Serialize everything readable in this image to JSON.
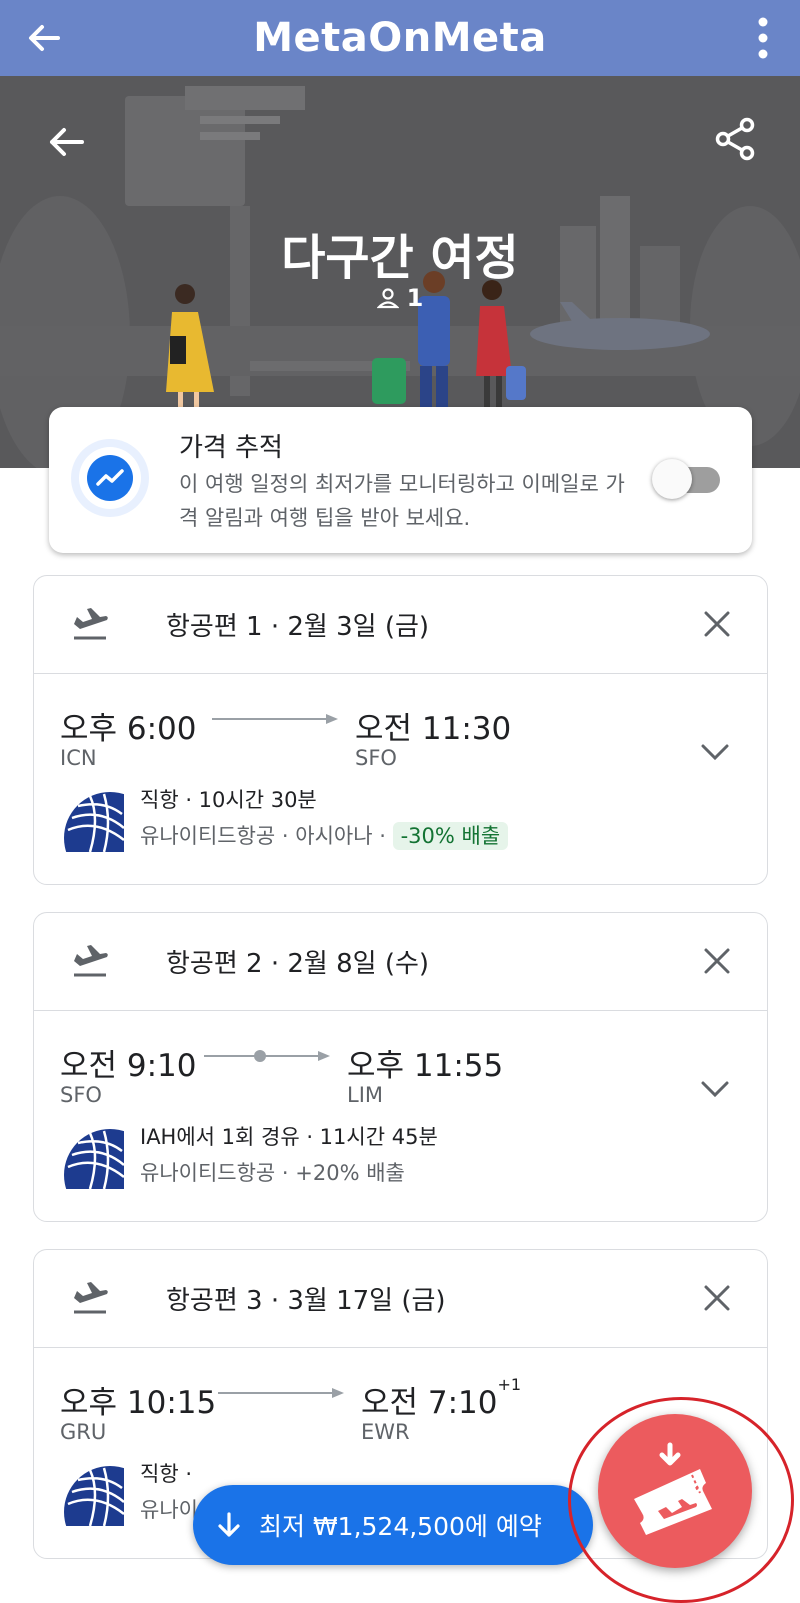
{
  "app_bar": {
    "title": "MetaOnMeta"
  },
  "hero": {
    "title": "다구간 여정",
    "passengers": "1"
  },
  "price_tracking": {
    "title": "가격 추적",
    "description": "이 여행 일정의 최저가를 모니터링하고 이메일로 가격 알림과 여행 팁을 받아 보세요.",
    "enabled": false
  },
  "flights": [
    {
      "header": "항공편 1 · 2월 3일 (금)",
      "depart_time": "오후 6:00",
      "depart_code": "ICN",
      "arrive_time": "오전 11:30",
      "arrive_plus": "",
      "arrive_code": "SFO",
      "stops_duration": "직항 · 10시간 30분",
      "airlines": "유나이티드항공 · 아시아나 · ",
      "emissions": "-30% 배출"
    },
    {
      "header": "항공편 2 · 2월 8일 (수)",
      "depart_time": "오전 9:10",
      "depart_code": "SFO",
      "arrive_time": "오후 11:55",
      "arrive_plus": "",
      "arrive_code": "LIM",
      "stops_duration": "IAH에서 1회 경유 · 11시간 45분",
      "airlines": "유나이티드항공 · +20% 배출",
      "emissions": ""
    },
    {
      "header": "항공편 3 · 3월 17일 (금)",
      "depart_time": "오후 10:15",
      "depart_code": "GRU",
      "arrive_time": "오전 7:10",
      "arrive_plus": "+1",
      "arrive_code": "EWR",
      "stops_duration": "직항 ·",
      "airlines": "유나이",
      "emissions": ""
    }
  ],
  "book_button": {
    "label": "최저 ₩1,524,500에 예약"
  },
  "colors": {
    "app_bar": "#6a85c8",
    "primary": "#1a73e8",
    "fab": "#ec5b5e",
    "highlight_ring": "#d6232a"
  }
}
